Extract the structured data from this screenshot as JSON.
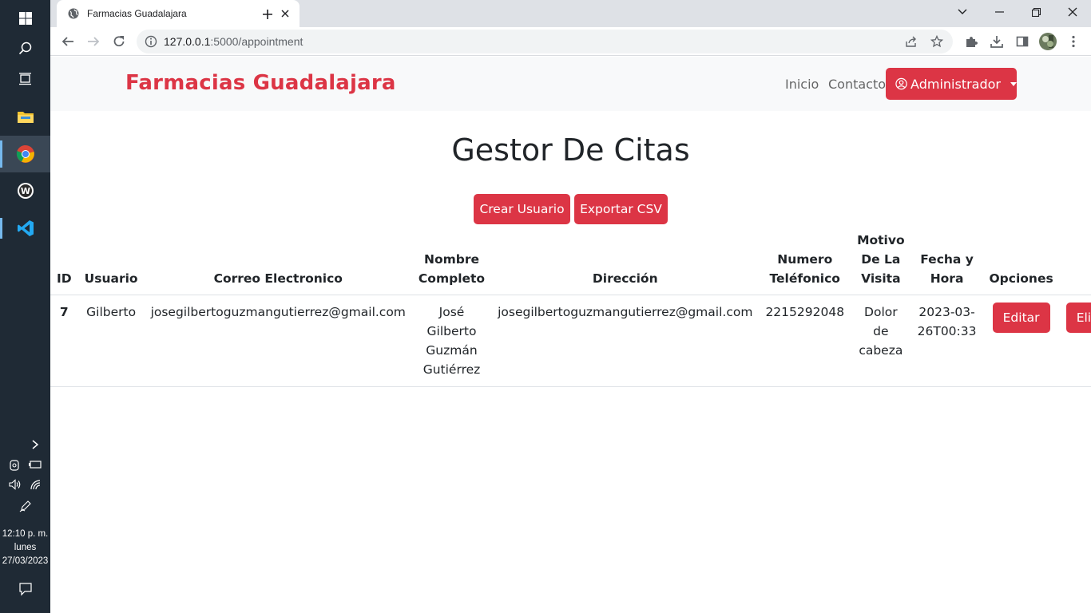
{
  "taskbar": {
    "clock": {
      "time": "12:10 p. m.",
      "day": "lunes",
      "date": "27/03/2023"
    }
  },
  "browser": {
    "tab_title": "Farmacias Guadalajara",
    "url_host": "127.0.0.1",
    "url_path": ":5000/appointment"
  },
  "navbar": {
    "brand": "Farmacias Guadalajara",
    "links": [
      "Inicio",
      "Contacto"
    ],
    "admin_label": "Administrador"
  },
  "main": {
    "title": "Gestor De Citas",
    "buttons": {
      "create": "Crear Usuario",
      "export": "Exportar CSV"
    }
  },
  "table": {
    "headers": [
      "ID",
      "Usuario",
      "Correo Electronico",
      "Nombre Completo",
      "Dirección",
      "Numero Teléfonico",
      "Motivo De La Visita",
      "Fecha y Hora",
      "Opciones"
    ],
    "rows": [
      {
        "id": "7",
        "usuario": "Gilberto",
        "correo": "josegilbertoguzmangutierrez@gmail.com",
        "nombre": "José Gilberto Guzmán Gutiérrez",
        "direccion": "josegilbertoguzmangutierrez@gmail.com",
        "telefono": "2215292048",
        "motivo": "Dolor de cabeza",
        "fecha": "2023-03-26T00:33",
        "edit_label": "Editar",
        "delete_label": "Eliminar"
      }
    ]
  },
  "colors": {
    "accent": "#dc3545",
    "taskbar": "#1f2a35"
  }
}
